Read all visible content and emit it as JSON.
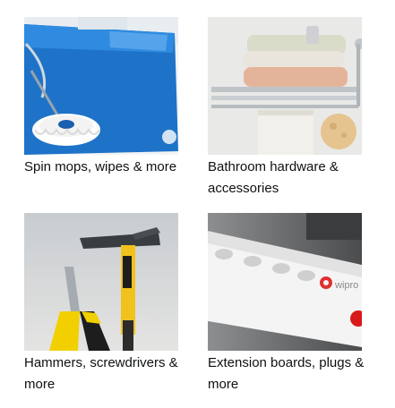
{
  "cards": [
    {
      "label": "Spin mops, wipes & more",
      "image": "spin-mop-bucket-image"
    },
    {
      "label": "Bathroom hardware & accessories",
      "image": "towel-rack-image"
    },
    {
      "label": "Hammers, screwdrivers & more",
      "image": "hammer-pliers-image"
    },
    {
      "label": "Extension boards, plugs & more",
      "image": "extension-board-image"
    }
  ]
}
